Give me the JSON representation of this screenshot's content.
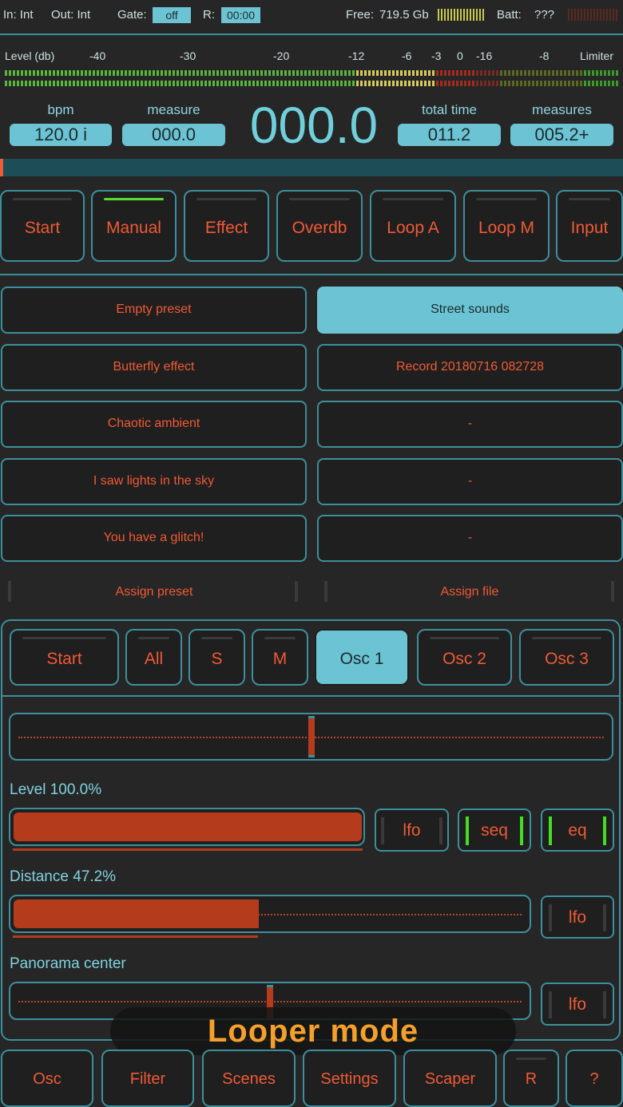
{
  "status_bar": {
    "in": "In: Int",
    "out": "Out: Int",
    "gate_label": "Gate:",
    "gate_value": "off",
    "r_label": "R:",
    "r_value": "00:00",
    "free_label": "Free:",
    "free_value": "719.5 Gb",
    "batt_label": "Batt:",
    "batt_value": "???"
  },
  "meter": {
    "label": "Level (db)",
    "ticks": [
      "-40",
      "-30",
      "-20",
      "-12",
      "-6",
      "-3",
      "0",
      "-16",
      "-8",
      "Limiter"
    ]
  },
  "header": {
    "bpm_label": "bpm",
    "bpm_value": "120.0 i",
    "measure_label": "measure",
    "measure_value": "000.0",
    "big_time": "000.0",
    "total_time_label": "total time",
    "total_time_value": "011.2",
    "measures_label": "measures",
    "measures_value": "005.2+"
  },
  "mode_buttons": [
    "Start",
    "Manual",
    "Effect",
    "Overdb",
    "Loop A",
    "Loop M",
    "Input"
  ],
  "active_mode": "Manual",
  "presets_left": [
    "Empty preset",
    "Butterfly effect",
    "Chaotic ambient",
    "I saw lights in the sky",
    "You have a glitch!"
  ],
  "presets_right": [
    "Street sounds",
    "Record 20180716 082728",
    "-",
    "-",
    "-"
  ],
  "selected_preset": "Street sounds",
  "assign": {
    "preset": "Assign preset",
    "file": "Assign file"
  },
  "osc_tabs": [
    "Start",
    "All",
    "S",
    "M",
    "Osc 1",
    "Osc 2",
    "Osc 3"
  ],
  "active_osc_tab": "Osc 1",
  "sliders": {
    "position": 0.5,
    "level_label": "Level 100.0%",
    "level_value": 1.0,
    "distance_label": "Distance 47.2%",
    "distance_value": 0.472,
    "panorama_label": "Panorama center",
    "panorama_value": 0.5
  },
  "side_buttons": {
    "lfo": "lfo",
    "seq": "seq",
    "eq": "eq"
  },
  "toast": "Looper mode",
  "bottom_tabs": [
    "Osc",
    "Filter",
    "Scenes",
    "Settings",
    "Scaper",
    "R",
    "?"
  ],
  "colors": {
    "accent": "#6cc3d3",
    "text_orange": "#f05a36",
    "fill": "#b43c1c",
    "active_green": "#55dd33"
  }
}
